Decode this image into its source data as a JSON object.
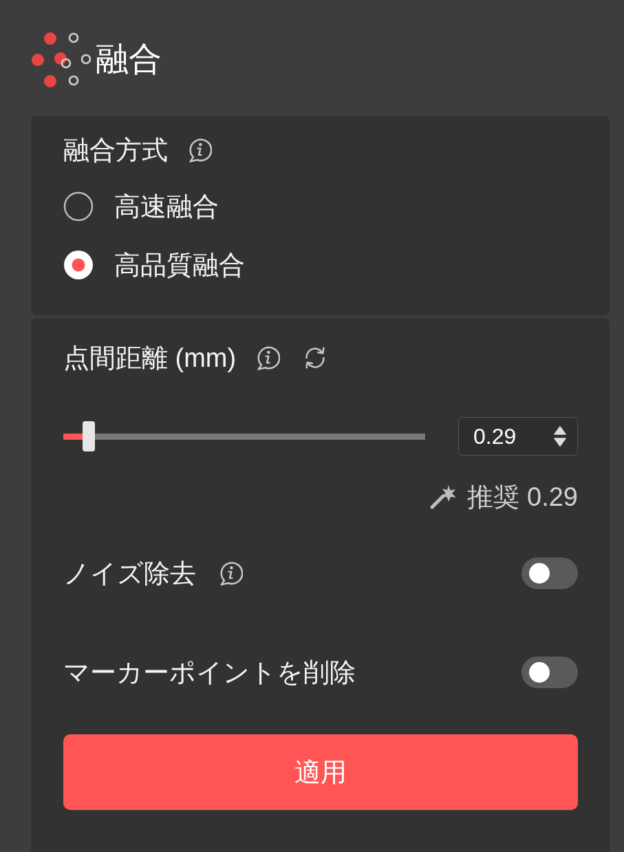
{
  "header": {
    "title": "融合"
  },
  "fusion_method": {
    "title": "融合方式",
    "options": [
      {
        "label": "高速融合",
        "selected": false
      },
      {
        "label": "高品質融合",
        "selected": true
      }
    ]
  },
  "point_spacing": {
    "title": "点間距離 (mm)",
    "slider": {
      "level": 0.07
    },
    "value": "0.29",
    "recommendation": "推奨 0.29"
  },
  "toggles": [
    {
      "label": "ノイズ除去",
      "has_info": true,
      "on": false
    },
    {
      "label": "マーカーポイントを削除",
      "has_info": false,
      "on": false
    }
  ],
  "apply_button": {
    "label": "適用"
  }
}
